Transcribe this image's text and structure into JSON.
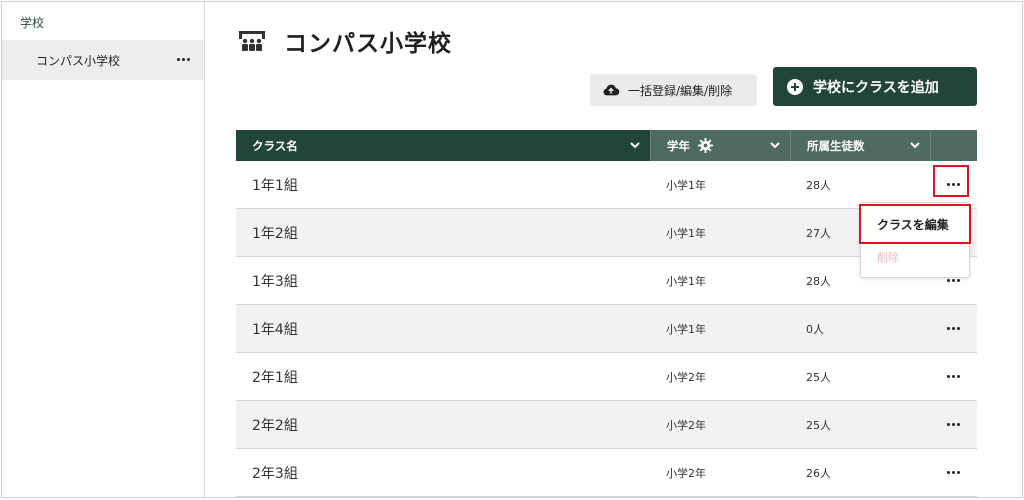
{
  "sidebar": {
    "section_label": "学校",
    "items": [
      {
        "label": "コンパス小学校"
      }
    ]
  },
  "page": {
    "title": "コンパス小学校"
  },
  "toolbar": {
    "bulk_label": "一括登録/編集/削除",
    "add_label": "学校にクラスを追加"
  },
  "table": {
    "headers": {
      "name": "クラス名",
      "grade": "学年",
      "count": "所属生徒数"
    },
    "rows": [
      {
        "name": "1年1組",
        "grade": "小学1年",
        "count": "28人"
      },
      {
        "name": "1年2組",
        "grade": "小学1年",
        "count": "27人"
      },
      {
        "name": "1年3組",
        "grade": "小学1年",
        "count": "28人"
      },
      {
        "name": "1年4組",
        "grade": "小学1年",
        "count": "0人"
      },
      {
        "name": "2年1組",
        "grade": "小学2年",
        "count": "25人"
      },
      {
        "name": "2年2組",
        "grade": "小学2年",
        "count": "25人"
      },
      {
        "name": "2年3組",
        "grade": "小学2年",
        "count": "26人"
      }
    ]
  },
  "menu": {
    "edit_label": "クラスを編集",
    "delete_label": "削除"
  },
  "colors": {
    "primary": "#22453a",
    "header_secondary": "#4f6a61",
    "highlight": "#e0141e",
    "delete_text": "#f0b9b9"
  },
  "icons": {
    "title": "school-icon",
    "bulk": "cloud-upload-icon",
    "add": "plus-circle-icon",
    "grade_settings": "gear-icon",
    "sort": "chevron-down-icon",
    "more": "more-horizontal-icon"
  }
}
